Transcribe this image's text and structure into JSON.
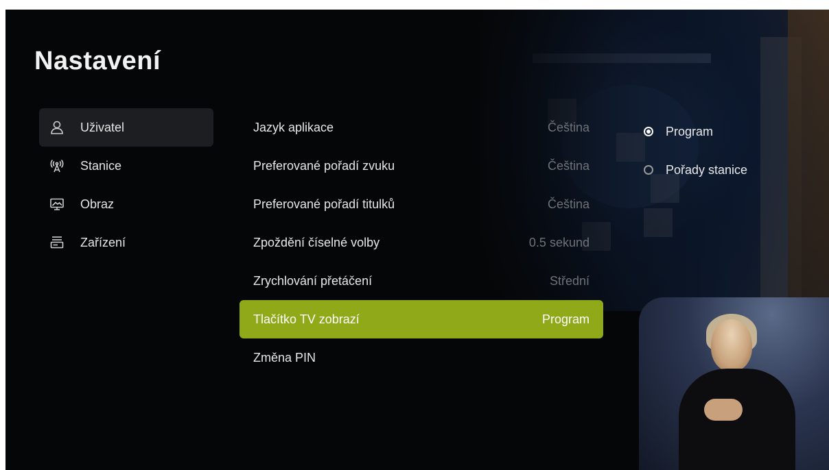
{
  "header": {
    "title": "Nastavení"
  },
  "sidebar": {
    "items": [
      {
        "label": "Uživatel",
        "icon": "user-icon",
        "active": true
      },
      {
        "label": "Stanice",
        "icon": "antenna-icon",
        "active": false
      },
      {
        "label": "Obraz",
        "icon": "display-icon",
        "active": false
      },
      {
        "label": "Zařízení",
        "icon": "set-top-box-icon",
        "active": false
      }
    ]
  },
  "settings": {
    "rows": [
      {
        "label": "Jazyk aplikace",
        "value": "Čeština"
      },
      {
        "label": "Preferované pořadí zvuku",
        "value": "Čeština"
      },
      {
        "label": "Preferované pořadí titulků",
        "value": "Čeština"
      },
      {
        "label": "Zpoždění číselné volby",
        "value": "0.5 sekund"
      },
      {
        "label": "Zrychlování přetáčení",
        "value": "Střední"
      },
      {
        "label": "Tlačítko TV zobrazí",
        "value": "Program",
        "selected": true
      },
      {
        "label": "Změna PIN",
        "value": ""
      }
    ]
  },
  "options": {
    "items": [
      {
        "label": "Program",
        "checked": true
      },
      {
        "label": "Pořady stanice",
        "checked": false
      }
    ]
  },
  "colors": {
    "accent": "#8fa919",
    "background": "#050607",
    "active_sidebar": "#1c1e21",
    "muted_value": "#6f7378"
  }
}
